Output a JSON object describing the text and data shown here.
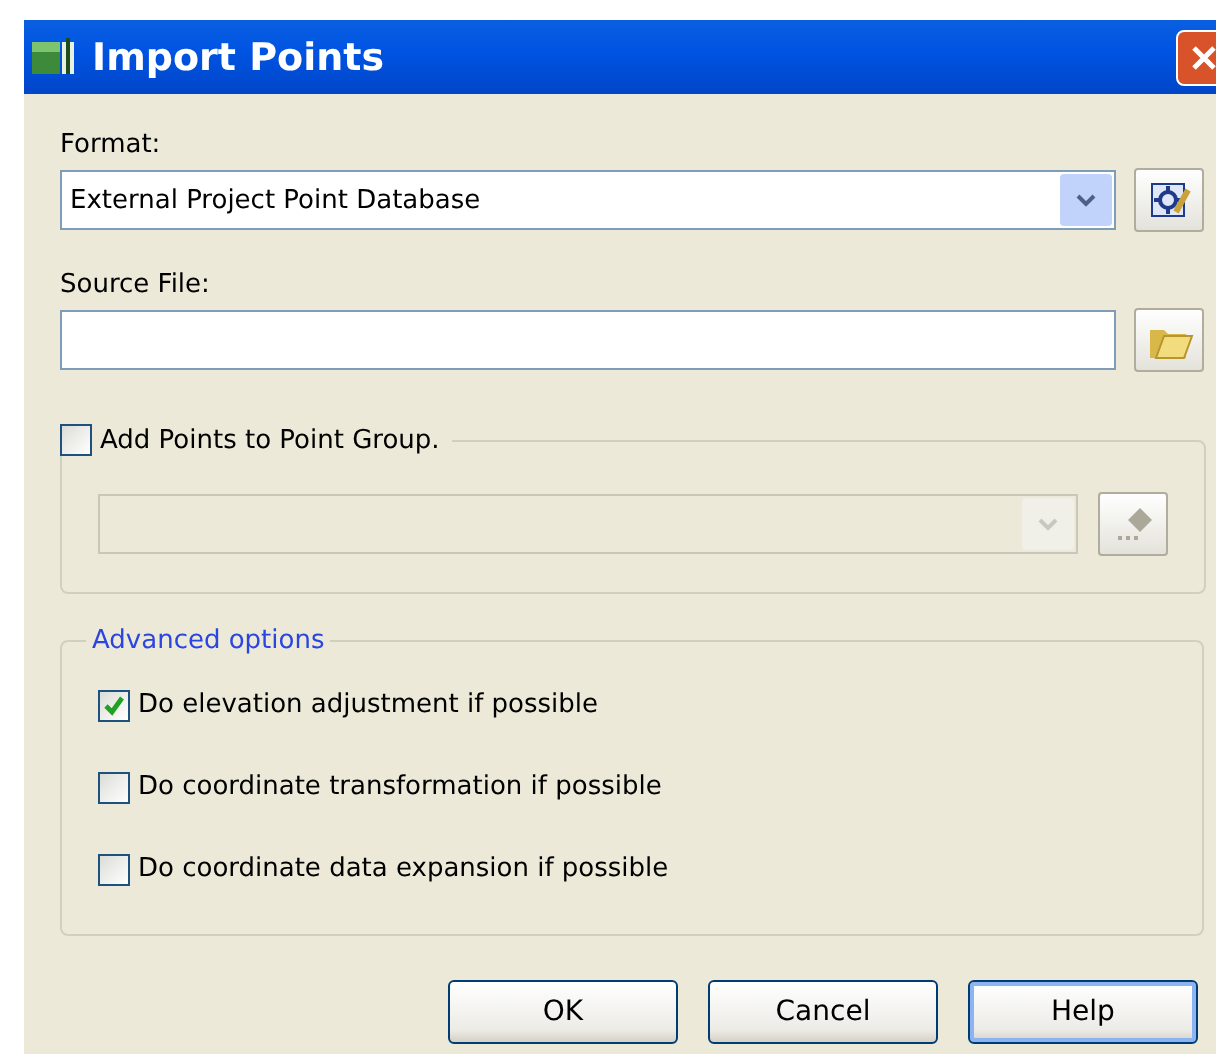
{
  "window": {
    "title": "Import Points"
  },
  "format": {
    "label": "Format:",
    "value": "External Project Point Database"
  },
  "source_file": {
    "label": "Source File:"
  },
  "point_group": {
    "label": "Add Points to Point Group.",
    "checked": false
  },
  "advanced": {
    "title": "Advanced options",
    "options": [
      {
        "label": "Do elevation adjustment if possible",
        "checked": true
      },
      {
        "label": "Do coordinate transformation if possible",
        "checked": false
      },
      {
        "label": "Do coordinate data expansion if possible",
        "checked": false
      }
    ]
  },
  "buttons": [
    {
      "label": "OK",
      "focused": false
    },
    {
      "label": "Cancel",
      "focused": false
    },
    {
      "label": "Help",
      "focused": true
    }
  ]
}
